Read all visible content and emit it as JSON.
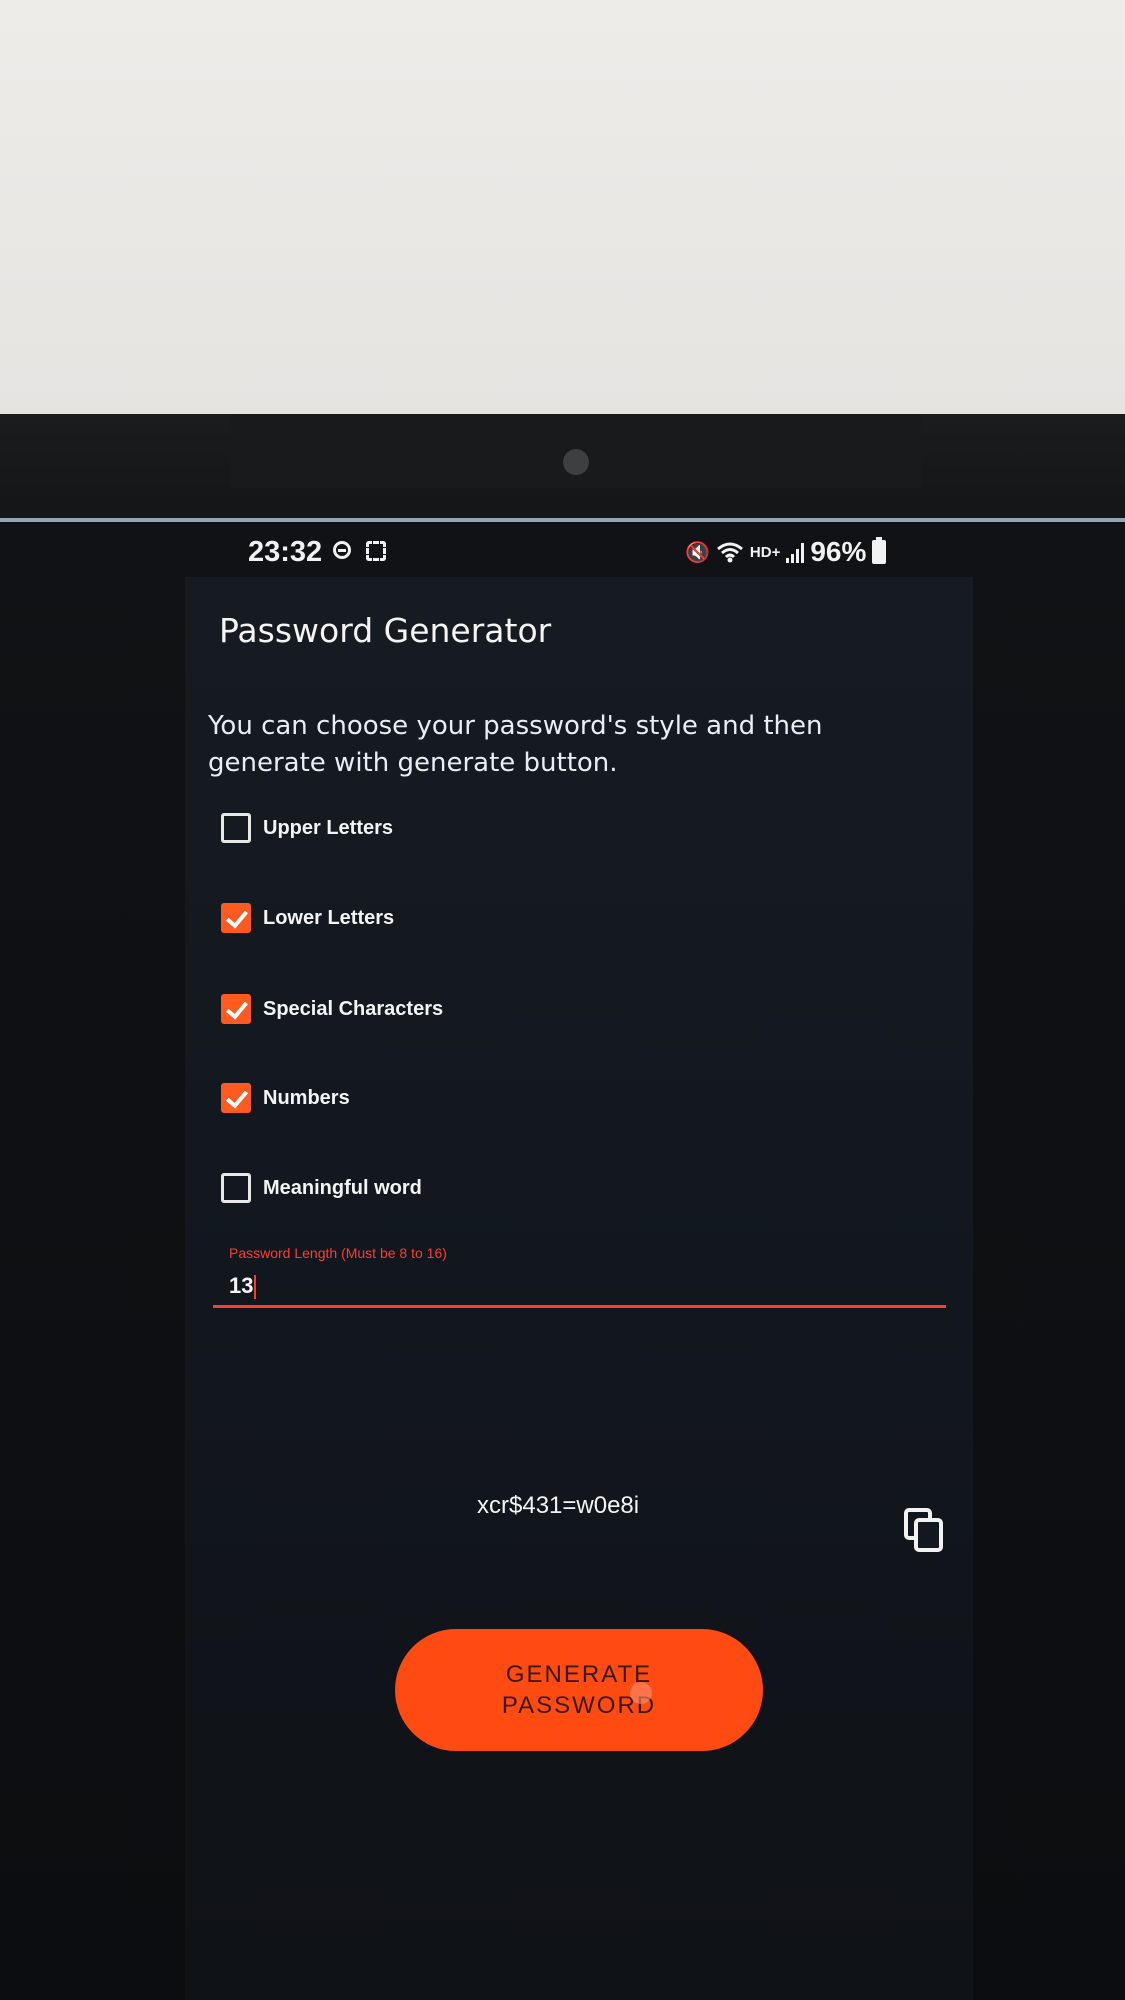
{
  "status_bar": {
    "time": "23:32",
    "icons": [
      "do-not-disturb-icon",
      "screenshot-icon",
      "mute-icon",
      "wifi-icon",
      "signal-icon",
      "battery-icon"
    ],
    "network": "HD+",
    "battery": "96%"
  },
  "app": {
    "title": "Password Generator",
    "description": "You can choose your password's style and then generate with generate button.",
    "options": [
      {
        "label": "Upper Letters",
        "checked": false
      },
      {
        "label": "Lower Letters",
        "checked": true
      },
      {
        "label": "Special Characters",
        "checked": true
      },
      {
        "label": "Numbers",
        "checked": true
      },
      {
        "label": "Meaningful word",
        "checked": false
      }
    ],
    "length_field": {
      "label": "Password Length (Must be 8 to 16)",
      "value": "13"
    },
    "generated_password": "xcr$431=w0e8i",
    "copy_icon": "copy-icon",
    "generate_button": {
      "line1": "GENERATE",
      "line2": "PASSWORD"
    }
  },
  "colors": {
    "accent": "#ff5a1f",
    "error_red": "#ff3b30",
    "background": "#13181f",
    "text": "#f4f4f4"
  }
}
